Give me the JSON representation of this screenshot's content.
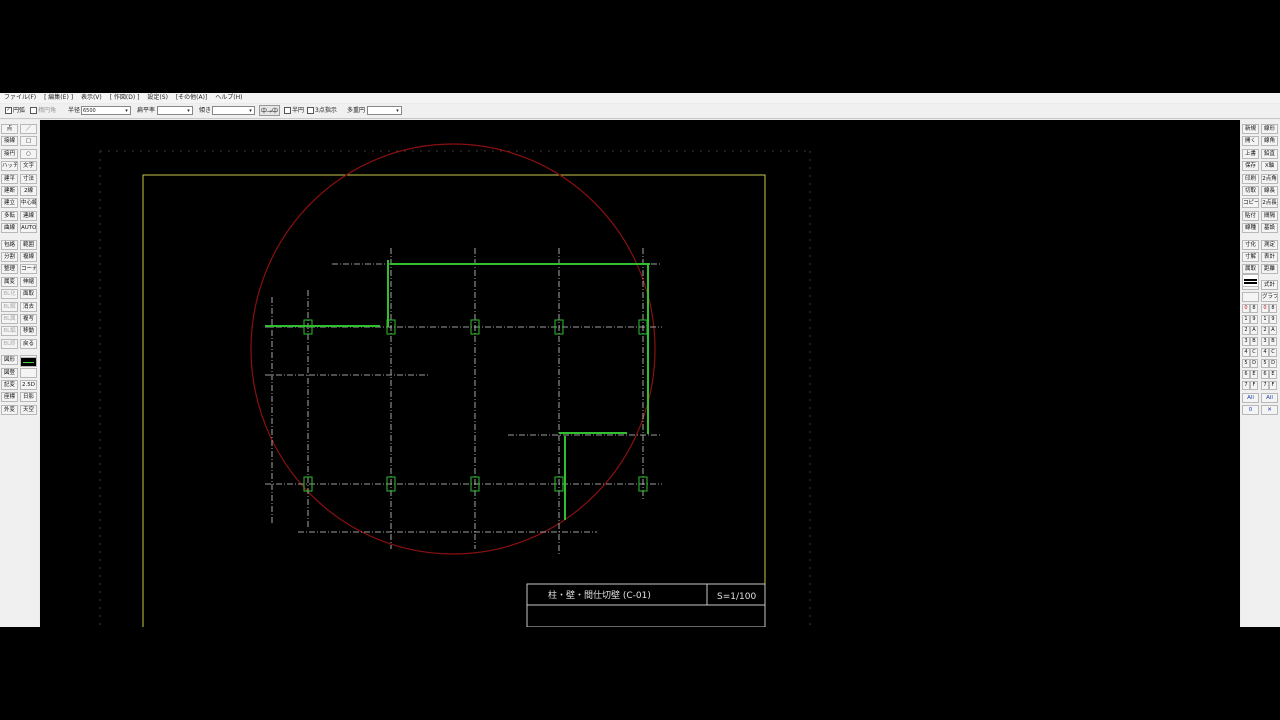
{
  "menu": [
    "ファイル(F)",
    "[ 編集(E) ]",
    "表示(V)",
    "[ 作図(D) ]",
    "設定(S)",
    "[その他(A)]",
    "ヘルプ(H)"
  ],
  "options": {
    "circle_check": "円弧",
    "ellipse_check": "楕円角",
    "radius_label": "半径",
    "radius_value": "6500",
    "flat_label": "扁平率",
    "tilt_label": "傾き",
    "midpoint_button": "中→中",
    "half_circle": "半円",
    "three_point": "3点指示",
    "polygon_label": "多重円"
  },
  "left_tools": [
    [
      "点",
      "／"
    ],
    [
      "接線",
      "□"
    ],
    [
      "接円",
      "○"
    ],
    [
      "ハッチ",
      "文字"
    ],
    [
      "建平",
      "寸法"
    ],
    [
      "建断",
      "2線"
    ],
    [
      "建立",
      "中心線"
    ],
    [
      "多転",
      "連線"
    ],
    [
      "曲線",
      "AUTO"
    ],
    [
      "包絡",
      "範囲"
    ],
    [
      "分割",
      "複線"
    ],
    [
      "整理",
      "コーナー"
    ],
    [
      "属変",
      "伸縮"
    ],
    [
      "BL化",
      "面取"
    ],
    [
      "BL解",
      "消去"
    ],
    [
      "BL属",
      "複写"
    ],
    [
      "BL編",
      "移動"
    ],
    [
      "BL終",
      "戻る"
    ],
    [
      "図形",
      ""
    ],
    [
      "図登",
      ""
    ],
    [
      "記変",
      "2.5D"
    ],
    [
      "座標",
      "日影"
    ],
    [
      "外変",
      "天空"
    ]
  ],
  "right_tools": [
    [
      "新規",
      "線形"
    ],
    [
      "開く",
      "線角"
    ],
    [
      "上書",
      "鉛直"
    ],
    [
      "保存",
      "X軸"
    ],
    [
      "印刷",
      "2点角"
    ],
    [
      "切取",
      "線長"
    ],
    [
      "コピー",
      "2点長"
    ],
    [
      "貼付",
      "間隔"
    ],
    [
      "線種",
      "基設"
    ],
    [
      "寸化",
      "測定"
    ],
    [
      "寸解",
      "表計"
    ],
    [
      "属取",
      "距離"
    ],
    [
      "",
      "式計"
    ],
    [
      "",
      "グラフ"
    ]
  ],
  "layer_labels": {
    "row0": [
      "0",
      "8",
      "0",
      "8"
    ],
    "rows": [
      [
        "1",
        "9",
        "1",
        "9"
      ],
      [
        "2",
        "A",
        "2",
        "A"
      ],
      [
        "3",
        "B",
        "3",
        "B"
      ],
      [
        "4",
        "C",
        "4",
        "C"
      ],
      [
        "5",
        "D",
        "5",
        "D"
      ],
      [
        "6",
        "E",
        "6",
        "E"
      ],
      [
        "7",
        "F",
        "7",
        "F"
      ]
    ],
    "all_left": "All",
    "all_right": "All",
    "zero": "0",
    "close": "✕"
  },
  "drawing": {
    "title": "柱・壁・間仕切壁 (C-01)",
    "scale": "S=1/100"
  },
  "colors": {
    "frame": "#c8c84a",
    "circle": "#8a1010",
    "grid": "#d0d0d0",
    "wall": "#2fbf2f",
    "column": "#2fbf2f"
  }
}
